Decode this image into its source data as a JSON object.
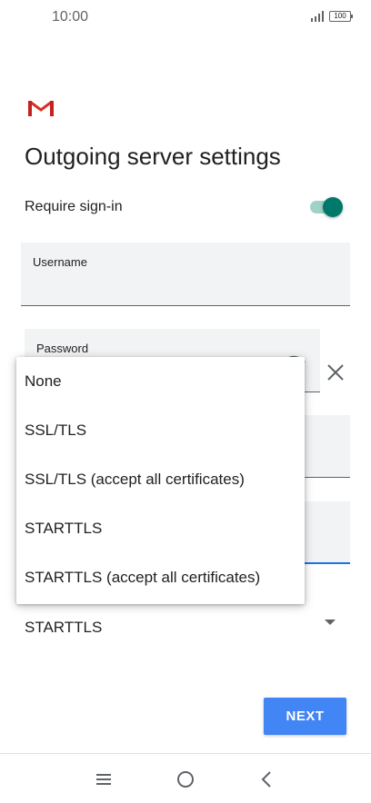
{
  "status_bar": {
    "time": "10:00",
    "battery": "100"
  },
  "header": {
    "title": "Outgoing server settings"
  },
  "require_signin": {
    "label": "Require sign-in",
    "enabled": true
  },
  "fields": {
    "username": {
      "label": "Username",
      "value": ""
    },
    "password": {
      "label": "Password",
      "value": ""
    }
  },
  "security": {
    "selected": "STARTTLS"
  },
  "menu": {
    "options": [
      "None",
      "SSL/TLS",
      "SSL/TLS (accept all certificates)",
      "STARTTLS",
      "STARTTLS (accept all certificates)"
    ]
  },
  "buttons": {
    "next": "NEXT"
  },
  "colors": {
    "accent": "#4285f4",
    "toggle": "#00796b",
    "focus_line": "#1a73e8"
  },
  "icons": [
    "gmail-logo-icon",
    "eye-icon",
    "close-icon",
    "dropdown-caret-icon",
    "menu-icon",
    "home-icon",
    "back-icon"
  ]
}
